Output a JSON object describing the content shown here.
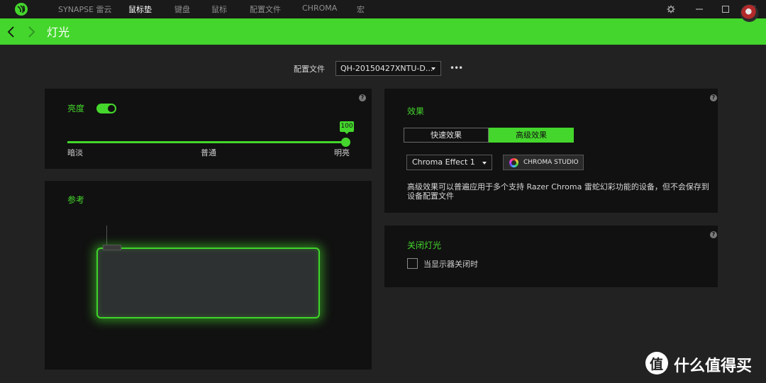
{
  "app": {
    "logo_icon": "razer-logo-icon",
    "tabs": [
      {
        "label": "SYNAPSE 雷云",
        "active": false
      },
      {
        "label": "鼠标垫",
        "active": true
      },
      {
        "label": "键盘",
        "active": false
      },
      {
        "label": "鼠标",
        "active": false
      },
      {
        "label": "配置文件",
        "active": false
      },
      {
        "label": "CHROMA",
        "active": false
      },
      {
        "label": "宏",
        "active": false
      }
    ],
    "window_controls": [
      "settings-icon",
      "minimize-icon",
      "maximize-icon",
      "close-icon"
    ],
    "accent_color": "#44d62c"
  },
  "header": {
    "title": "灯光",
    "back_icon": "chevron-left-icon",
    "forward_icon": "chevron-right-icon",
    "avatar_icon": "user-avatar"
  },
  "profile": {
    "label": "配置文件",
    "value": "QH-20150427XNTU-D...",
    "more_label": "•••"
  },
  "brightness": {
    "title": "亮度",
    "enabled": true,
    "value": "100",
    "level_percent": 100,
    "min_label": "暗淡",
    "mid_label": "普通",
    "max_label": "明亮"
  },
  "reference": {
    "title": "参考"
  },
  "effects": {
    "title": "效果",
    "tab_quick": "快速效果",
    "tab_advanced": "高级效果",
    "active_tab": "advanced",
    "select_value": "Chroma Effect 1",
    "studio_button": "CHROMA STUDIO",
    "description": "高级效果可以普遍应用于多个支持 Razer Chroma 雷蛇幻彩功能的设备，但不会保存到设备配置文件"
  },
  "lights_off": {
    "title": "关闭灯光",
    "checkbox_label": "当显示器关闭时",
    "checked": false
  },
  "help": {
    "label": "?"
  },
  "watermark": {
    "icon_char": "值",
    "text": "什么值得买"
  }
}
